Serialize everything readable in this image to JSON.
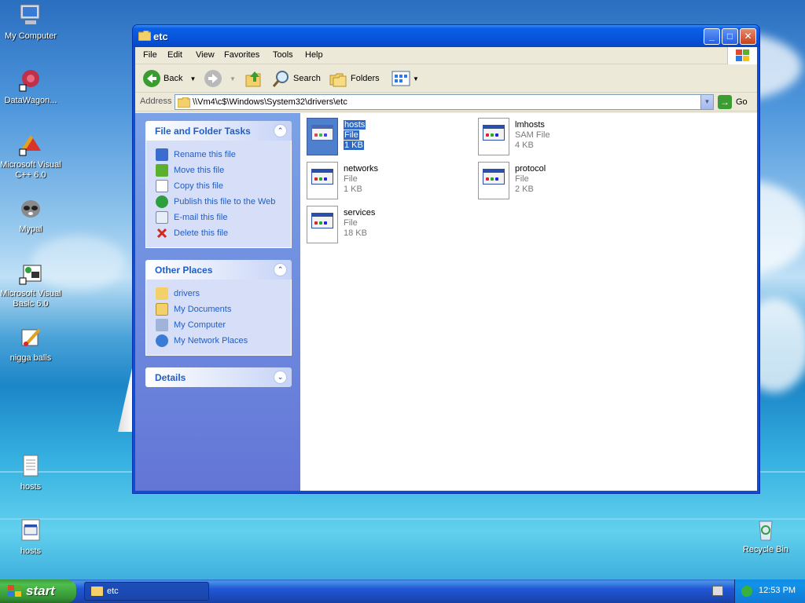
{
  "desktop": {
    "icons": [
      {
        "label": "My Computer",
        "icon": "computer-icon"
      },
      {
        "label": "DataWagon...",
        "icon": "datawagon-icon"
      },
      {
        "label": "Microsoft Visual C++ 6.0",
        "icon": "visual-cpp-icon"
      },
      {
        "label": "Mypal",
        "icon": "mypal-icon"
      },
      {
        "label": "Microsoft Visual Basic 6.0",
        "icon": "visual-basic-icon"
      },
      {
        "label": "nigga balls",
        "icon": "paint-icon"
      },
      {
        "label": "hosts",
        "icon": "text-file-icon"
      },
      {
        "label": "hosts",
        "icon": "system-file-icon"
      },
      {
        "label": "Recycle Bin",
        "icon": "recycle-bin-icon"
      }
    ]
  },
  "window": {
    "title": "etc",
    "menu": [
      "File",
      "Edit",
      "View",
      "Favorites",
      "Tools",
      "Help"
    ],
    "toolbar": {
      "back": "Back",
      "search": "Search",
      "folders": "Folders"
    },
    "address": {
      "label": "Address",
      "value": "\\\\Vm4\\c$\\Windows\\System32\\drivers\\etc",
      "go": "Go"
    },
    "tasks": {
      "file_folder_tasks": {
        "title": "File and Folder Tasks",
        "items": [
          {
            "label": "Rename this file",
            "icon": "rename-icon"
          },
          {
            "label": "Move this file",
            "icon": "move-icon"
          },
          {
            "label": "Copy this file",
            "icon": "copy-icon"
          },
          {
            "label": "Publish this file to the Web",
            "icon": "publish-web-icon"
          },
          {
            "label": "E-mail this file",
            "icon": "email-icon"
          },
          {
            "label": "Delete this file",
            "icon": "delete-icon"
          }
        ]
      },
      "other_places": {
        "title": "Other Places",
        "items": [
          {
            "label": "drivers",
            "icon": "folder-icon"
          },
          {
            "label": "My Documents",
            "icon": "my-documents-icon"
          },
          {
            "label": "My Computer",
            "icon": "my-computer-icon"
          },
          {
            "label": "My Network Places",
            "icon": "network-places-icon"
          }
        ]
      },
      "details": {
        "title": "Details"
      }
    },
    "files": [
      {
        "name": "hosts",
        "type": "File",
        "size": "1 KB",
        "selected": true
      },
      {
        "name": "lmhosts",
        "type": "SAM File",
        "size": "4 KB",
        "selected": false
      },
      {
        "name": "networks",
        "type": "File",
        "size": "1 KB",
        "selected": false
      },
      {
        "name": "protocol",
        "type": "File",
        "size": "2 KB",
        "selected": false
      },
      {
        "name": "services",
        "type": "File",
        "size": "18 KB",
        "selected": false
      }
    ]
  },
  "taskbar": {
    "start": "start",
    "task_label": "etc",
    "clock": "12:53 PM"
  }
}
